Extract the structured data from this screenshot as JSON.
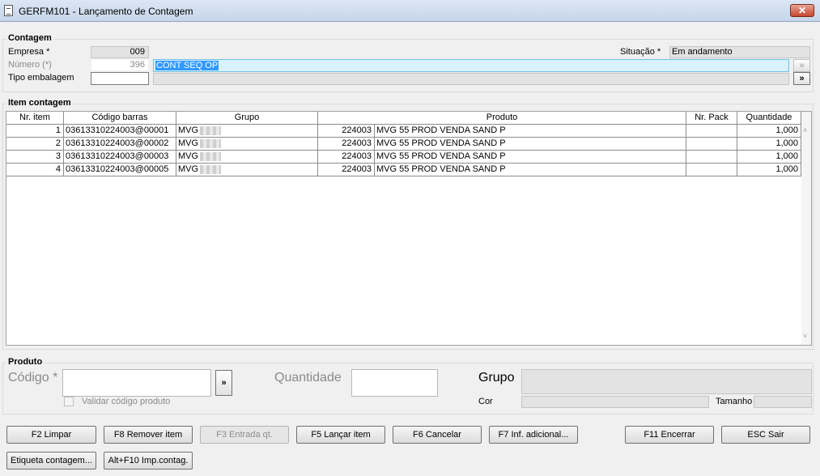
{
  "window": {
    "title": "GERFM101 - Lançamento de Contagem",
    "close_label": "✕"
  },
  "contagem": {
    "legend": "Contagem",
    "empresa_label": "Empresa *",
    "empresa_value": "009",
    "numero_label": "Número (*)",
    "numero_value": "396",
    "numero_desc": "CONT SEQ OP",
    "tipo_embalagem_label": "Tipo embalagem",
    "tipo_embalagem_value": "",
    "situacao_label": "Situação *",
    "situacao_value": "Em andamento",
    "lookup_label": "»"
  },
  "item_contagem": {
    "legend": "Item contagem",
    "columns": [
      "Nr. item",
      "Código barras",
      "Grupo",
      "Produto",
      "Nr. Pack",
      "Quantidade"
    ],
    "rows": [
      {
        "nr": "1",
        "codigo": "03613310224003@00001",
        "grupo": "MVG",
        "produto_cod": "224003",
        "produto_desc": "MVG 55 PROD VENDA SAND P",
        "pack": "",
        "qtd": "1,000"
      },
      {
        "nr": "2",
        "codigo": "03613310224003@00002",
        "grupo": "MVG",
        "produto_cod": "224003",
        "produto_desc": "MVG 55 PROD VENDA SAND P",
        "pack": "",
        "qtd": "1,000"
      },
      {
        "nr": "3",
        "codigo": "03613310224003@00003",
        "grupo": "MVG",
        "produto_cod": "224003",
        "produto_desc": "MVG 55 PROD VENDA SAND P",
        "pack": "",
        "qtd": "1,000"
      },
      {
        "nr": "4",
        "codigo": "03613310224003@00005",
        "grupo": "MVG",
        "produto_cod": "224003",
        "produto_desc": "MVG 55 PROD VENDA SAND P",
        "pack": "",
        "qtd": "1,000"
      }
    ]
  },
  "produto": {
    "legend": "Produto",
    "codigo_label": "Código *",
    "codigo_value": "",
    "lookup_label": "»",
    "quantidade_label": "Quantidade",
    "quantidade_value": "",
    "grupo_label": "Grupo",
    "cor_label": "Cor",
    "tamanho_label": "Tamanho",
    "validar_label": "Validar código produto"
  },
  "buttons": {
    "limpar": "F2 Limpar",
    "remover": "F8 Remover item",
    "entrada": "F3 Entrada qt.",
    "lancar": "F5 Lançar item",
    "cancelar": "F6 Cancelar",
    "inf_adicional": "F7 Inf. adicional...",
    "encerrar": "F11 Encerrar",
    "sair": "ESC Sair",
    "etiqueta": "Etiqueta contagem...",
    "imp_contag": "Alt+F10 Imp.contag."
  }
}
